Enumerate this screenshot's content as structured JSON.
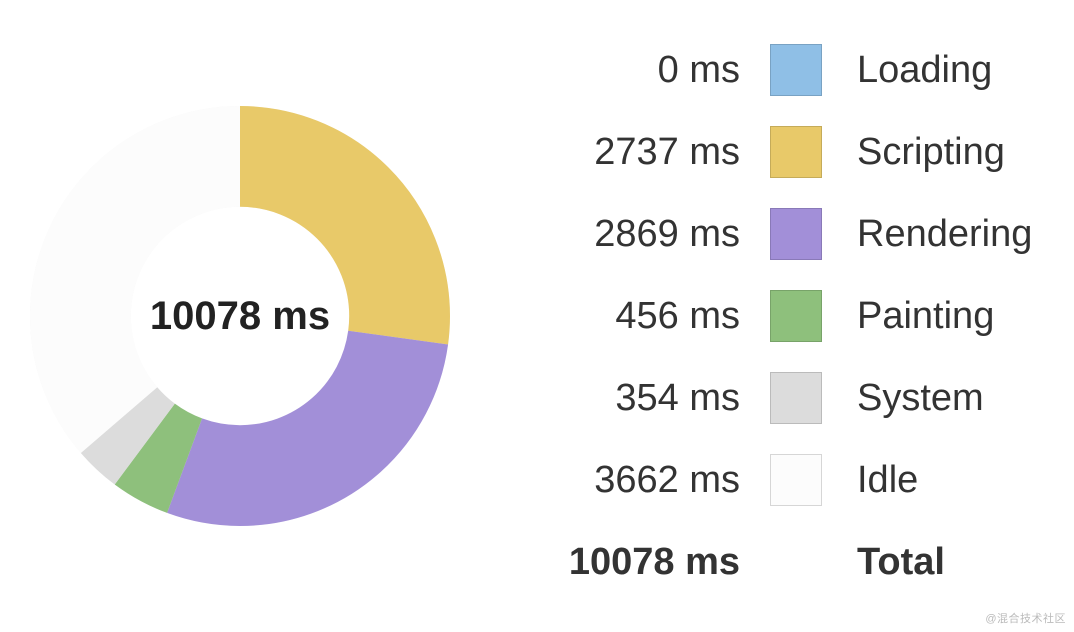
{
  "chart_data": {
    "type": "pie",
    "title": "",
    "total_ms": 10078,
    "unit": "ms",
    "series": [
      {
        "name": "Loading",
        "value": 0,
        "color": "#8fbfe6"
      },
      {
        "name": "Scripting",
        "value": 2737,
        "color": "#e8c969"
      },
      {
        "name": "Rendering",
        "value": 2869,
        "color": "#a28fd8"
      },
      {
        "name": "Painting",
        "value": 456,
        "color": "#8ec07c"
      },
      {
        "name": "System",
        "value": 354,
        "color": "#dcdcdc"
      },
      {
        "name": "Idle",
        "value": 3662,
        "color": "#fcfcfc"
      }
    ]
  },
  "center_label": "10078 ms",
  "legend": {
    "rows": [
      {
        "value": "0 ms",
        "label": "Loading",
        "color": "#8fbfe6"
      },
      {
        "value": "2737 ms",
        "label": "Scripting",
        "color": "#e8c969"
      },
      {
        "value": "2869 ms",
        "label": "Rendering",
        "color": "#a28fd8"
      },
      {
        "value": "456 ms",
        "label": "Painting",
        "color": "#8ec07c"
      },
      {
        "value": "354 ms",
        "label": "System",
        "color": "#dcdcdc"
      },
      {
        "value": "3662 ms",
        "label": "Idle",
        "color": "#fcfcfc"
      }
    ],
    "total": {
      "value": "10078 ms",
      "label": "Total"
    }
  },
  "watermark": "@混合技术社区"
}
